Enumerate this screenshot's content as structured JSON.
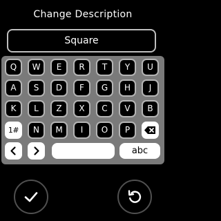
{
  "header": {
    "title": "Change Description"
  },
  "input": {
    "value": "Square"
  },
  "keyboard": {
    "rows": [
      [
        "Q",
        "W",
        "E",
        "R",
        "T",
        "Y",
        "U"
      ],
      [
        "A",
        "S",
        "D",
        "F",
        "G",
        "H",
        "J"
      ],
      [
        "K",
        "L",
        "Z",
        "X",
        "C",
        "V",
        "B"
      ],
      [
        "1#",
        "N",
        "M",
        "I",
        "O",
        "P"
      ]
    ],
    "backspace_icon": "backspace-icon",
    "left_icon": "chevron-left-icon",
    "right_icon": "chevron-right-icon",
    "mode_label": "abc"
  },
  "actions": {
    "confirm_icon": "check-icon",
    "reset_icon": "undo-icon"
  },
  "colors": {
    "background": "#000000",
    "keyboard_panel": "#7a7a7a",
    "key_border": "#b5b5b5",
    "key_light": "#ffffff",
    "button_ring": "#505050"
  }
}
